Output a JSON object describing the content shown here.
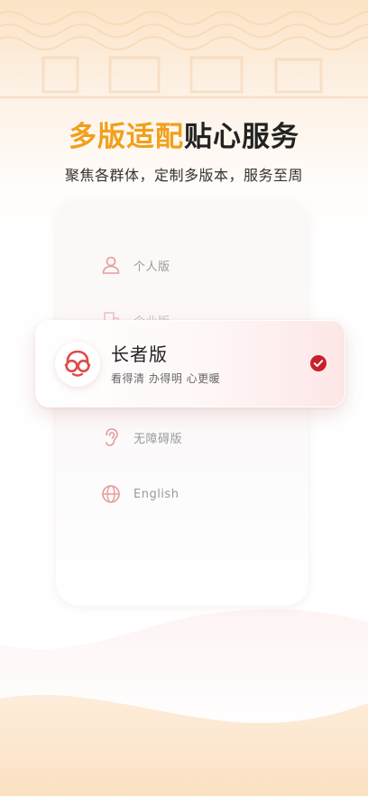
{
  "headline": {
    "part_accent": "多版适配",
    "part_dark": "贴心服务"
  },
  "subtitle": "聚焦各群体，定制多版本，服务至周",
  "versions": [
    {
      "label": "个人版",
      "icon": "person-icon"
    },
    {
      "label": "企业版",
      "icon": "building-icon"
    },
    {
      "label": "无障碍版",
      "icon": "ear-icon"
    },
    {
      "label": "English",
      "icon": "globe-icon"
    }
  ],
  "selected": {
    "label": "长者版",
    "description": "看得清 办得明 心更暖",
    "icon": "elder-glasses-icon",
    "check_icon": "check-circle-icon"
  },
  "colors": {
    "accent": "#f0a01c",
    "brand_red": "#e04a4a",
    "check_red": "#c8202a"
  }
}
